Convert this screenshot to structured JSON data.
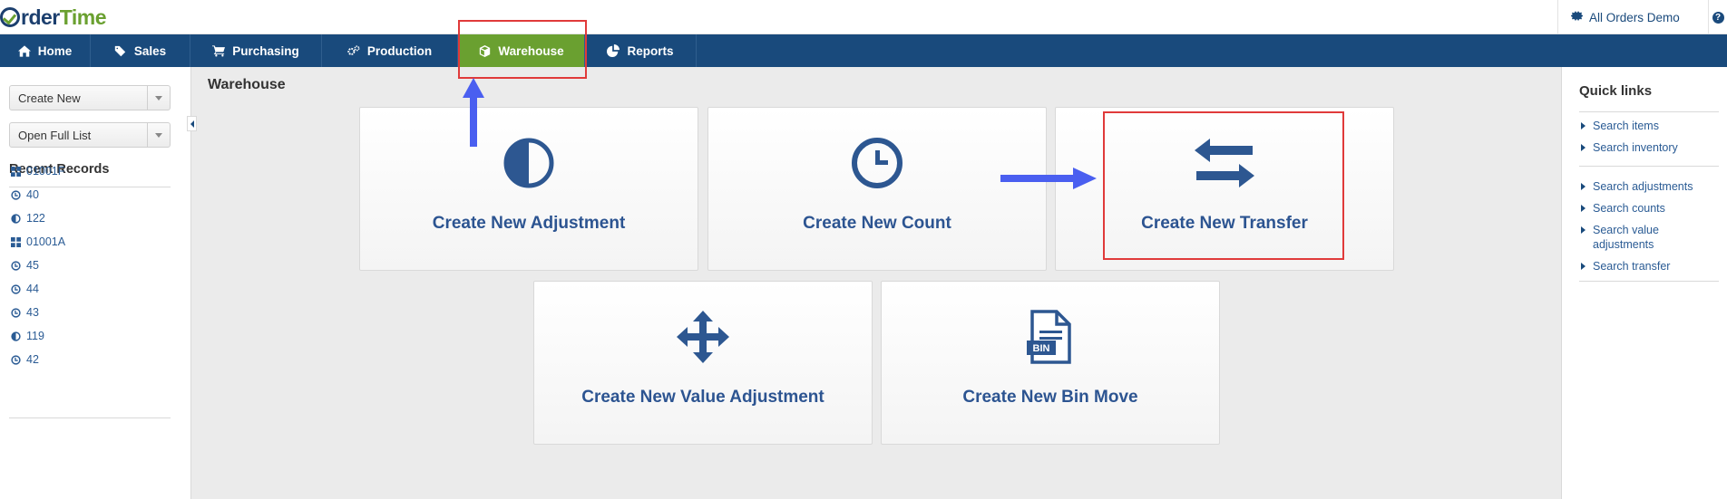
{
  "header": {
    "logo": {
      "o": "O",
      "rder": "rder",
      "time": "Time"
    },
    "company_label": "All Orders Demo",
    "help_label": "?"
  },
  "nav": {
    "items": [
      {
        "label": "Home",
        "icon": "home-icon"
      },
      {
        "label": "Sales",
        "icon": "tag-icon"
      },
      {
        "label": "Purchasing",
        "icon": "cart-icon"
      },
      {
        "label": "Production",
        "icon": "gears-icon"
      },
      {
        "label": "Warehouse",
        "icon": "box-icon",
        "active": true
      },
      {
        "label": "Reports",
        "icon": "pie-chart-icon"
      }
    ]
  },
  "sidebar": {
    "create_new": "Create New",
    "open_full_list": "Open Full List",
    "recent_title": "Recent Records",
    "records": [
      {
        "label": "01001F",
        "icon": "grid-icon"
      },
      {
        "label": "40",
        "icon": "clock-icon"
      },
      {
        "label": "122",
        "icon": "half-circle-icon"
      },
      {
        "label": "01001A",
        "icon": "grid-icon"
      },
      {
        "label": "45",
        "icon": "clock-icon"
      },
      {
        "label": "44",
        "icon": "clock-icon"
      },
      {
        "label": "43",
        "icon": "clock-icon"
      },
      {
        "label": "119",
        "icon": "half-circle-icon"
      },
      {
        "label": "42",
        "icon": "clock-icon"
      }
    ]
  },
  "main": {
    "title": "Warehouse",
    "cards": [
      {
        "label": "Create New Adjustment",
        "icon": "half-circle-icon"
      },
      {
        "label": "Create New Count",
        "icon": "clock-icon"
      },
      {
        "label": "Create New Transfer",
        "icon": "transfer-arrows-icon"
      },
      {
        "label": "Create New Value Adjustment",
        "icon": "move-arrows-icon"
      },
      {
        "label": "Create New Bin Move",
        "icon": "bin-document-icon",
        "icon_text": "BIN"
      }
    ]
  },
  "quick_links": {
    "title": "Quick links",
    "links": [
      "Search items",
      "Search inventory",
      "Search adjustments",
      "Search counts",
      "Search value adjustments",
      "Search transfer"
    ]
  },
  "colors": {
    "nav_bg": "#194a7c",
    "nav_active": "#6aa030",
    "card_text": "#2c5491",
    "annotation_red": "#e03a3a",
    "annotation_arrow": "#4a5ff0"
  }
}
